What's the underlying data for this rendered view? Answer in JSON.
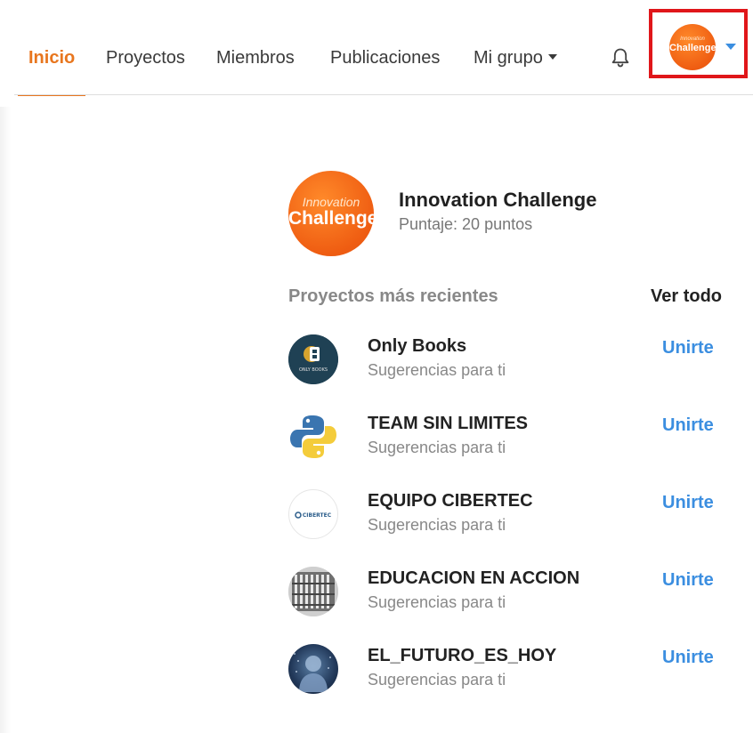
{
  "nav": {
    "items": [
      {
        "label": "Inicio",
        "active": true
      },
      {
        "label": "Proyectos",
        "active": false
      },
      {
        "label": "Miembros",
        "active": false
      },
      {
        "label": "Publicaciones",
        "active": false
      },
      {
        "label": "Mi grupo",
        "active": false,
        "dropdown": true
      }
    ],
    "icons": {
      "notifications": "bell-icon",
      "profile_menu": "chevron-down-icon"
    },
    "accent_color": "#e8761e",
    "highlight_color": "#e0161a"
  },
  "profile": {
    "logo_top": "Innovation",
    "logo_main": "Challenge"
  },
  "group": {
    "name": "Innovation Challenge",
    "score": "Puntaje: 20 puntos",
    "logo_top": "Innovation",
    "logo_main": "Challenge"
  },
  "projects_section": {
    "title": "Proyectos más recientes",
    "see_all_label": "Ver todo",
    "link_color": "#3b8ee0",
    "items": [
      {
        "name": "Only Books",
        "subtitle": "Sugerencias para ti",
        "join_label": "Unirte",
        "avatar_icon": "only-books-logo",
        "logo_text": "ONLY BOOKS"
      },
      {
        "name": "TEAM SIN LIMITES",
        "subtitle": "Sugerencias para ti",
        "join_label": "Unirte",
        "avatar_icon": "python-logo"
      },
      {
        "name": "EQUIPO CIBERTEC",
        "subtitle": "Sugerencias para ti",
        "join_label": "Unirte",
        "avatar_icon": "cibertec-logo",
        "logo_text": "CIBERTEC"
      },
      {
        "name": "EDUCACION EN ACCION",
        "subtitle": "Sugerencias para ti",
        "join_label": "Unirte",
        "avatar_icon": "building-photo"
      },
      {
        "name": "EL_FUTURO_ES_HOY",
        "subtitle": "Sugerencias para ti",
        "join_label": "Unirte",
        "avatar_icon": "person-photo"
      }
    ]
  }
}
